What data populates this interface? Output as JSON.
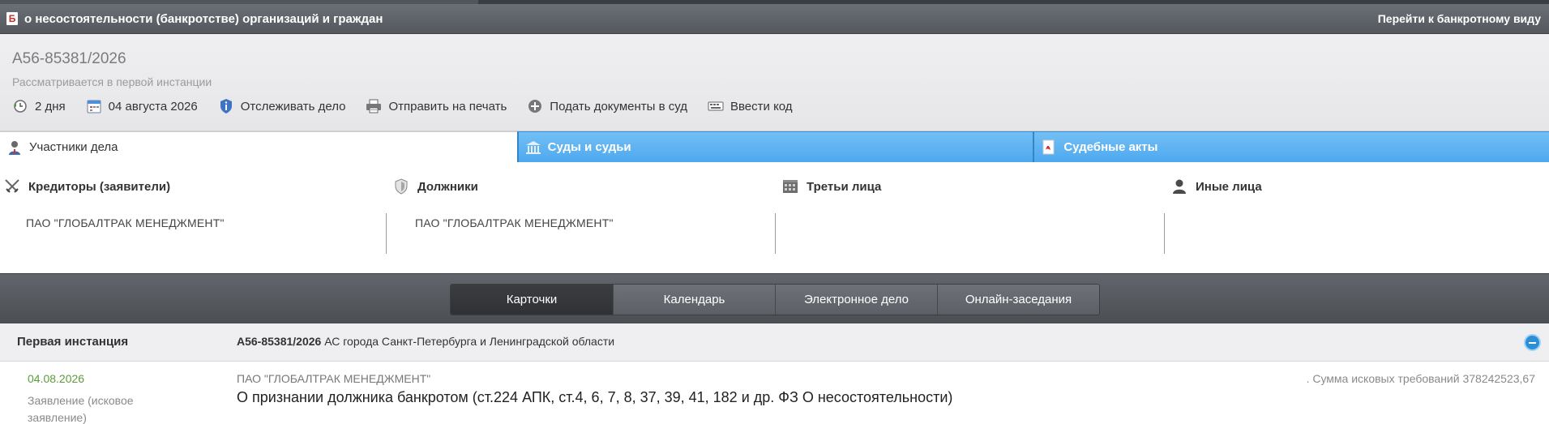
{
  "header": {
    "logo_letter": "Б",
    "title": "о несостоятельности (банкротстве) организаций и граждан",
    "link": "Перейти к банкротному виду"
  },
  "case": {
    "number": "А56-85381/2026",
    "status": "Рассматривается в первой инстанции",
    "actions": [
      {
        "icon": "history-icon",
        "label": "2 дня"
      },
      {
        "icon": "calendar-icon",
        "label": "04 августа 2026"
      },
      {
        "icon": "shield-info-icon",
        "label": "Отслеживать дело"
      },
      {
        "icon": "printer-icon",
        "label": "Отправить на печать"
      },
      {
        "icon": "plus-circle-icon",
        "label": "Подать документы в суд"
      },
      {
        "icon": "keyboard-icon",
        "label": "Ввести код"
      }
    ]
  },
  "tabs": [
    {
      "icon": "person-icon",
      "label": "Участники дела",
      "active": true
    },
    {
      "icon": "courthouse-icon",
      "label": "Суды и судьи",
      "active": false
    },
    {
      "icon": "pdf-icon",
      "label": "Судебные акты",
      "active": false
    }
  ],
  "participants": [
    {
      "icon": "swords-icon",
      "title": "Кредиторы (заявители)",
      "value": "ПАО \"ГЛОБАЛТРАК МЕНЕДЖМЕНТ\""
    },
    {
      "icon": "shield-icon",
      "title": "Должники",
      "value": "ПАО \"ГЛОБАЛТРАК МЕНЕДЖМЕНТ\""
    },
    {
      "icon": "building-icon",
      "title": "Третьи лица",
      "value": ""
    },
    {
      "icon": "user-icon",
      "title": "Иные лица",
      "value": ""
    }
  ],
  "view_switch": {
    "buttons": [
      "Карточки",
      "Календарь",
      "Электронное дело",
      "Онлайн-заседания"
    ],
    "active": "Карточки"
  },
  "instance": {
    "label": "Первая инстанция",
    "case_number": "А56-85381/2026",
    "court": "АС города Санкт-Петербурга и Ленинградской области"
  },
  "document": {
    "date": "04.08.2026",
    "type": "Заявление (исковое заявление)",
    "party": "ПАО \"ГЛОБАЛТРАК МЕНЕДЖМЕНТ\"",
    "title": "О признании должника банкротом (ст.224 АПК, ст.4, 6, 7, 8, 37, 39, 41, 182 и др. ФЗ О несостоятельности)",
    "sum": ". Сумма исковых требований 378242523,67"
  },
  "colors": {
    "tab_blue": "#5cb3f1",
    "date_green": "#5a9d3a",
    "collapse_blue": "#2a8fd6"
  }
}
